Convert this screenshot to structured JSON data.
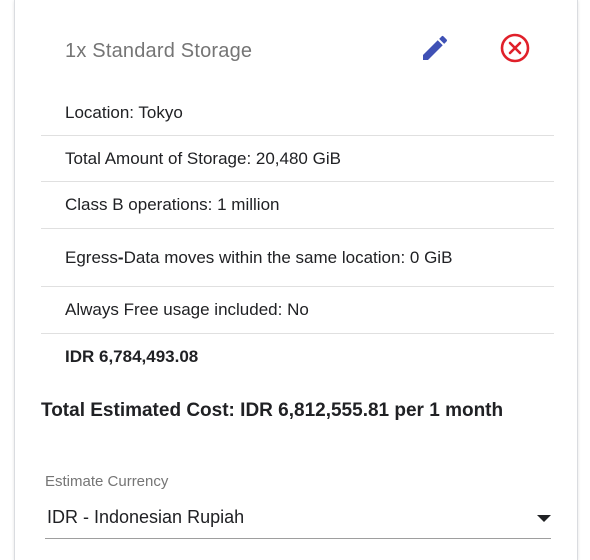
{
  "item": {
    "title": "1x Standard Storage",
    "edit_icon": "pencil-icon",
    "delete_icon": "circle-x-icon",
    "colors": {
      "edit": "#3f51b5",
      "delete": "#e0202a"
    }
  },
  "details": [
    "Location: Tokyo",
    "Total Amount of Storage: 20,480 GiB",
    "Class B operations: 1 million",
    "Egress - Data moves within the same location: 0 GiB",
    "Always Free usage included: No",
    "IDR 6,784,493.08"
  ],
  "egress_prefix": "Egress - ",
  "total": {
    "text": "Total Estimated Cost: IDR 6,812,555.81 per 1 month"
  },
  "currency": {
    "label": "Estimate Currency",
    "selected": "IDR - Indonesian Rupiah",
    "arrow_icon": "dropdown-arrow-icon"
  }
}
